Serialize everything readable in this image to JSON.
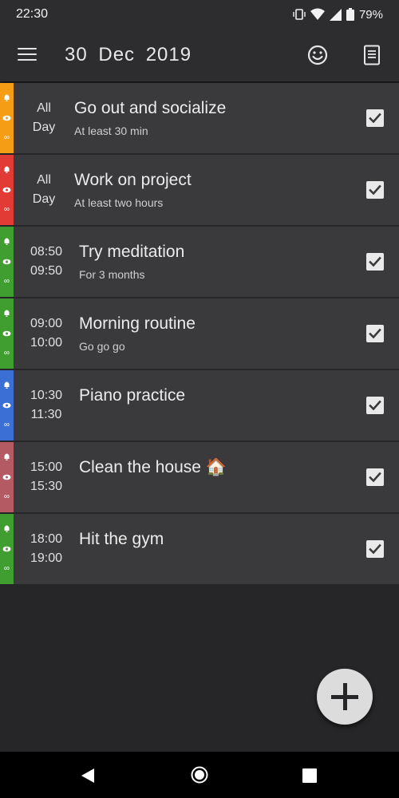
{
  "status_bar": {
    "time": "22:30",
    "battery": "79%",
    "icons": [
      "vibrate-icon",
      "wifi-icon",
      "signal-icon",
      "battery-icon"
    ]
  },
  "app_bar": {
    "title": "30  Dec  2019",
    "actions": [
      "menu-icon",
      "smile-icon",
      "note-icon"
    ]
  },
  "tasks": [
    {
      "time_start": "All",
      "time_end": "Day",
      "title": "Go out and socialize",
      "subtitle": "At least 30 min",
      "color": "#f59d14",
      "checked": true
    },
    {
      "time_start": "All",
      "time_end": "Day",
      "title": "Work on project",
      "subtitle": "At least two hours",
      "color": "#e23b35",
      "checked": true
    },
    {
      "time_start": "08:50",
      "time_end": "09:50",
      "title": "Try meditation",
      "subtitle": "For 3 months",
      "color": "#3f9e2f",
      "checked": true
    },
    {
      "time_start": "09:00",
      "time_end": "10:00",
      "title": "Morning routine",
      "subtitle": "Go go go",
      "color": "#3f9e2f",
      "checked": true
    },
    {
      "time_start": "10:30",
      "time_end": "11:30",
      "title": "Piano practice",
      "subtitle": "",
      "color": "#3b6fd6",
      "checked": true
    },
    {
      "time_start": "15:00",
      "time_end": "15:30",
      "title": "Clean the house 🏠",
      "subtitle": "",
      "color": "#b45a63",
      "checked": true
    },
    {
      "time_start": "18:00",
      "time_end": "19:00",
      "title": "Hit the gym",
      "subtitle": "",
      "color": "#3f9e2f",
      "checked": true
    }
  ],
  "fab": {
    "icon": "plus-icon"
  },
  "nav_bar": {
    "icons": [
      "back-icon",
      "home-icon",
      "recents-icon"
    ]
  }
}
